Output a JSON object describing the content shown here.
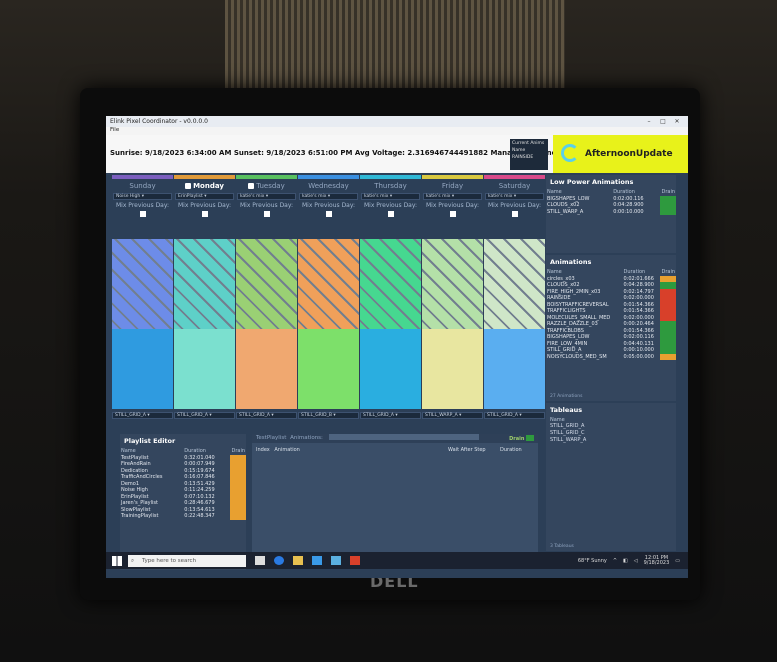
{
  "app": {
    "title": "Elink Pixel Coordinator - v0.0.0.0",
    "menu": "File"
  },
  "header": {
    "info": "Sunrise: 9/18/2023 6:34:00 AM  Sunset: 9/18/2023 6:51:00 PM  Avg Voltage: 2.316946744491882  Managers Connected: 41 of 42",
    "current_label": "Current Anims",
    "name_label": "Name",
    "current_value": "RAINSIDE",
    "active_animation": "AfternoonUpdate"
  },
  "days": [
    {
      "name": "Sunday",
      "locked": false,
      "bold": false,
      "select": "Noise High",
      "mix": "Mix Previous Day:",
      "grid": "STILL_GRID_A",
      "stripe": "#7b5fbf",
      "top": "#6d8ce8",
      "bottom": "#2f9be0"
    },
    {
      "name": "Monday",
      "locked": true,
      "bold": true,
      "select": "ErinPlaylist",
      "mix": "Mix Previous Day:",
      "grid": "STILL_GRID_A",
      "stripe": "#e09a3a",
      "top": "#5ed0c8",
      "bottom": "#7be0cf"
    },
    {
      "name": "Tuesday",
      "locked": true,
      "bold": false,
      "select": "katie's mix",
      "mix": "Mix Previous Day:",
      "grid": "STILL_GRID_A",
      "stripe": "#58c060",
      "top": "#9ad074",
      "bottom": "#f0a870"
    },
    {
      "name": "Wednesday",
      "locked": false,
      "bold": false,
      "select": "katie's mix",
      "mix": "Mix Previous Day:",
      "grid": "STILL_GRID_B",
      "stripe": "#3a8fe0",
      "top": "#f0a05a",
      "bottom": "#7de06a"
    },
    {
      "name": "Thursday",
      "locked": false,
      "bold": false,
      "select": "katie's mix",
      "mix": "Mix Previous Day:",
      "grid": "STILL_GRID_A",
      "stripe": "#2fb8d6",
      "top": "#46d890",
      "bottom": "#2aaee0"
    },
    {
      "name": "Friday",
      "locked": false,
      "bold": false,
      "select": "katie's mix",
      "mix": "Mix Previous Day:",
      "grid": "STILL_WARP_A",
      "stripe": "#d8c840",
      "top": "#b4e0a8",
      "bottom": "#e8e6a0"
    },
    {
      "name": "Saturday",
      "locked": false,
      "bold": false,
      "select": "katie's mix",
      "mix": "Mix Previous Day:",
      "grid": "STILL_GRID_A",
      "stripe": "#d84a8a",
      "top": "#cfe6c8",
      "bottom": "#5aaef0"
    }
  ],
  "low_power": {
    "title": "Low Power Animations",
    "headers": [
      "Name",
      "Duration",
      "Drain"
    ],
    "rows": [
      {
        "name": "BIGSHAPES_LOW",
        "duration": "0:02:00.116",
        "drain": "#2e9a3e"
      },
      {
        "name": "CLOUDS_x02",
        "duration": "0:04:28.900",
        "drain": "#2e9a3e"
      },
      {
        "name": "STILL_WARP_A",
        "duration": "0:00:10.000",
        "drain": "#2e9a3e"
      }
    ]
  },
  "animations": {
    "title": "Animations",
    "headers": [
      "Name",
      "Duration",
      "Drain"
    ],
    "rows": [
      {
        "name": "circles_x03",
        "duration": "0:02:01.666",
        "drain": "#e8a030"
      },
      {
        "name": "CLOUDS_x02",
        "duration": "0:04:28.900",
        "drain": "#2e9a3e"
      },
      {
        "name": "FIRE_HIGH_2MIN_x03",
        "duration": "0:02:14.797",
        "drain": "#d8402a"
      },
      {
        "name": "RAINSIDE",
        "duration": "0:02:00.000",
        "drain": "#d8402a"
      },
      {
        "name": "BOISYTRAFFICREVERSAL",
        "duration": "0:01:54.366",
        "drain": "#d8402a"
      },
      {
        "name": "TRAFFICLIGHTS",
        "duration": "0:01:54.366",
        "drain": "#d8402a"
      },
      {
        "name": "MOLECULES_SMALL_MED",
        "duration": "0:02:00.000",
        "drain": "#d8402a"
      },
      {
        "name": "RAZZLE_DAZZLE_03",
        "duration": "0:00:20.464",
        "drain": "#2e9a3e"
      },
      {
        "name": "TRAFFICBLOBS",
        "duration": "0:01:54.366",
        "drain": "#2e9a3e"
      },
      {
        "name": "BIGSHAPES_LOW",
        "duration": "0:02:00.116",
        "drain": "#2e9a3e"
      },
      {
        "name": "FIRE_LOW_4MIN",
        "duration": "0:04:40.131",
        "drain": "#2e9a3e"
      },
      {
        "name": "STILL_GRID_A",
        "duration": "0:00:10.000",
        "drain": "#2e9a3e"
      },
      {
        "name": "NOISYCLOUDS_MED_SM",
        "duration": "0:05:00.000",
        "drain": "#e8a030"
      }
    ],
    "footer": "27 Animations"
  },
  "tableaus": {
    "title": "Tableaus",
    "header": "Name",
    "rows": [
      "STILL_GRID_A",
      "STILL_GRID_C",
      "STILL_WARP_A"
    ],
    "footer": "3 Tableaus"
  },
  "playlist_editor": {
    "title": "Playlist Editor",
    "headers": [
      "Name",
      "Duration",
      "Drain"
    ],
    "rows": [
      {
        "name": "TestPlaylist",
        "duration": "0:32:01.040",
        "drain": "#e8a030"
      },
      {
        "name": "FireAndRain",
        "duration": "0:00:07.949",
        "drain": "#e8a030"
      },
      {
        "name": "Dedication",
        "duration": "0:15:19.674",
        "drain": "#e8a030"
      },
      {
        "name": "TrafficAndCircles",
        "duration": "0:16:07.846",
        "drain": "#e8a030"
      },
      {
        "name": "Demo1",
        "duration": "0:13:51.429",
        "drain": "#e8a030"
      },
      {
        "name": "Noise High",
        "duration": "0:11:24.259",
        "drain": "#e8a030"
      },
      {
        "name": "ErinPlaylist",
        "duration": "0:07:10.132",
        "drain": "#e8a030"
      },
      {
        "name": "Jaren's_Playlist",
        "duration": "0:28:46.679",
        "drain": "#e8a030"
      },
      {
        "name": "SlowPlaylist",
        "duration": "0:13:54.613",
        "drain": "#e8a030"
      },
      {
        "name": "TrainingPlaylist",
        "duration": "0:22:48.347",
        "drain": "#e8a030"
      }
    ],
    "footer": "15 Playlists"
  },
  "playlist": {
    "name_label": "TestPlaylist",
    "anim_label": "Animations:",
    "drain_label": "Drain",
    "col_index": "Index",
    "col_anim": "Animation",
    "col_wait": "Wait After Step",
    "col_duration": "Duration"
  },
  "taskbar": {
    "search_placeholder": "Type here to search",
    "weather": "68°F Sunny",
    "time": "12:01 PM",
    "date": "9/18/2023"
  },
  "brand": "DELL"
}
